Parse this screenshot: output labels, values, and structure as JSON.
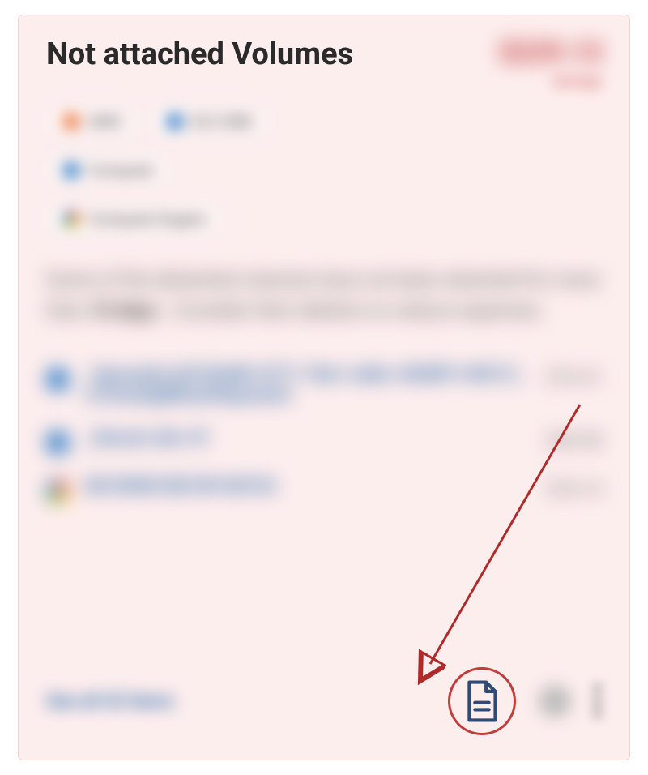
{
  "card": {
    "title": "Not attached Volumes",
    "savings_amount": "$229.13",
    "savings_label": "savings"
  },
  "chips": [
    {
      "iconColorClass": "dot-orange",
      "label": "AWS"
    },
    {
      "iconColorClass": "dot-blue",
      "label": "EC2 EBS"
    },
    {
      "iconColorClass": "dot-blue",
      "label": "Compute"
    },
    {
      "iconColorClass": "dot-google",
      "label": "Compute Engine"
    }
  ],
  "description": {
    "pre": "Some of the detached volumes have not been attached for more than ",
    "bold": "10 days",
    "post": ". Consider their deletion to reduce expenses."
  },
  "items": [
    {
      "iconClass": "cloud-blue",
      "name": "_SecureAI_b0103af8-4771-7be1-a66c-3028f11407c7_csToushgWeenHeqcanztv",
      "cost": "$74.41"
    },
    {
      "iconClass": "cloud-blue",
      "name": "_Secure-dev-4l",
      "cost": "$49.58"
    },
    {
      "iconClass": "cloud-google",
      "name": "801090018010f140724",
      "cost": "$18.14"
    }
  ],
  "footer": {
    "see_all": "See all 42 items"
  },
  "actions": {
    "doc_name": "document-icon",
    "info_name": "info-icon",
    "more_name": "more-menu"
  }
}
